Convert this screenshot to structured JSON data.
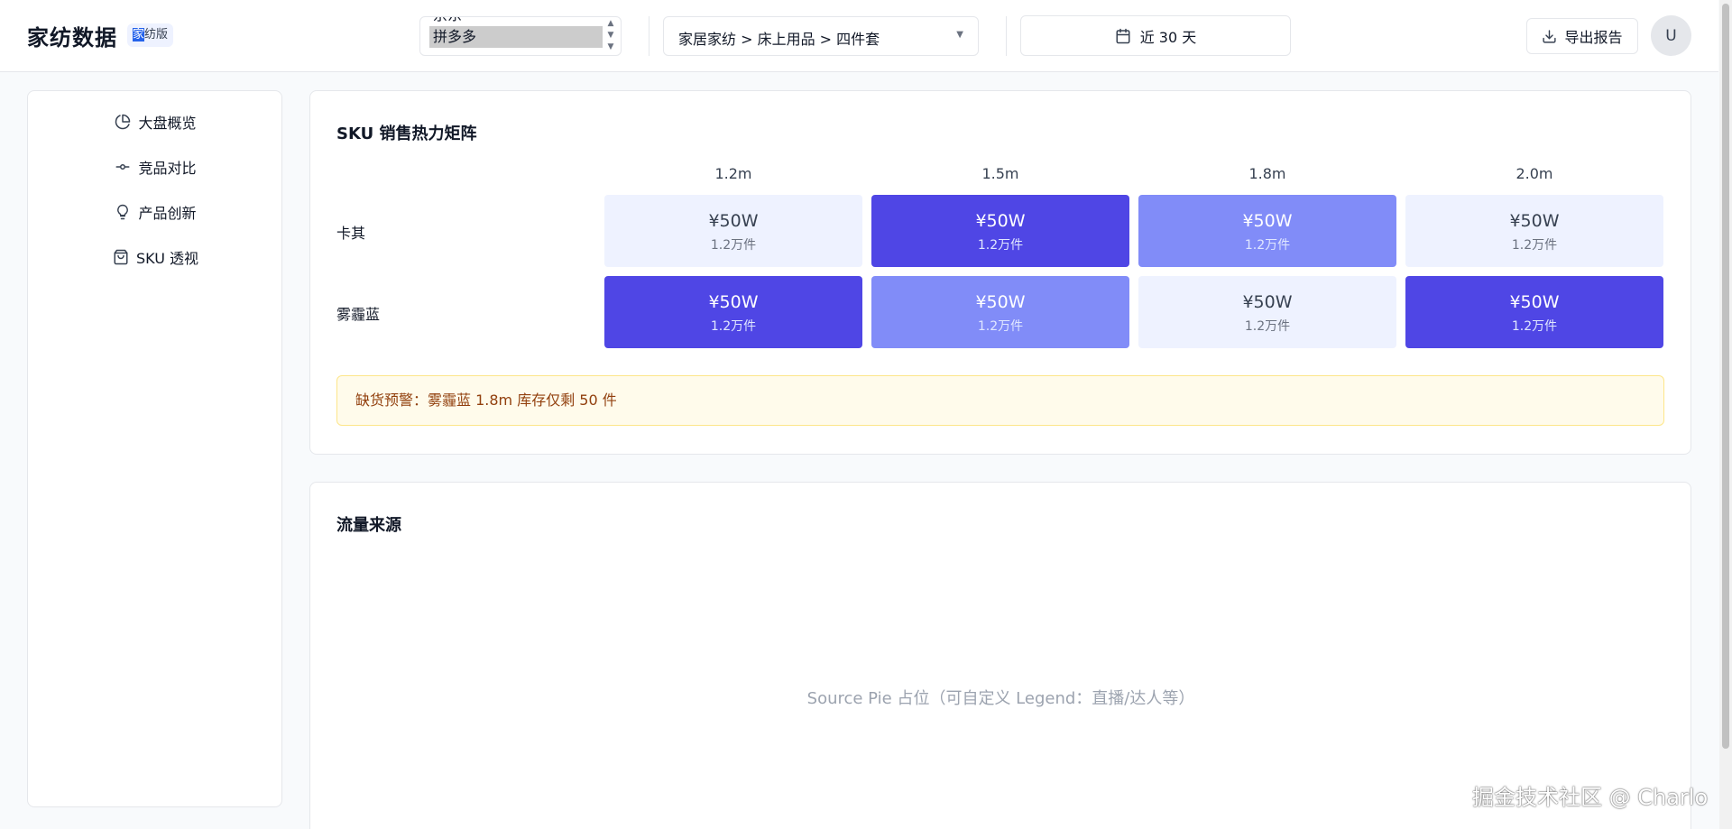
{
  "header": {
    "brand": "家纺数据",
    "badge_highlight": "家",
    "badge_rest": "纺版",
    "platform": {
      "prev_option": "京东",
      "selected": "拼多多"
    },
    "category": "家居家纺 > 床上用品 > 四件套",
    "date_range": "近 30 天",
    "export_label": "导出报告",
    "avatar": "U"
  },
  "sidebar": {
    "items": [
      {
        "label": "大盘概览",
        "icon": "pie-chart-icon"
      },
      {
        "label": "竞品对比",
        "icon": "commit-icon"
      },
      {
        "label": "产品创新",
        "icon": "lightbulb-icon"
      },
      {
        "label": "SKU 透视",
        "icon": "shopping-bag-icon"
      }
    ]
  },
  "heatmap": {
    "title": "SKU 销售热力矩阵",
    "columns": [
      "1.2m",
      "1.5m",
      "1.8m",
      "2.0m"
    ],
    "rows": [
      {
        "label": "卡其",
        "cells": [
          {
            "amount": "¥50W",
            "volume": "1.2万件",
            "level": "low"
          },
          {
            "amount": "¥50W",
            "volume": "1.2万件",
            "level": "high"
          },
          {
            "amount": "¥50W",
            "volume": "1.2万件",
            "level": "mid"
          },
          {
            "amount": "¥50W",
            "volume": "1.2万件",
            "level": "low"
          }
        ]
      },
      {
        "label": "雾霾蓝",
        "cells": [
          {
            "amount": "¥50W",
            "volume": "1.2万件",
            "level": "high"
          },
          {
            "amount": "¥50W",
            "volume": "1.2万件",
            "level": "mid"
          },
          {
            "amount": "¥50W",
            "volume": "1.2万件",
            "level": "low"
          },
          {
            "amount": "¥50W",
            "volume": "1.2万件",
            "level": "high"
          }
        ]
      }
    ],
    "alert": "缺货预警：雾霾蓝 1.8m 库存仅剩 50 件"
  },
  "traffic": {
    "title": "流量来源",
    "placeholder": "Source Pie 占位（可自定义 Legend：直播/达人等）"
  },
  "watermark": "掘金技术社区 @ Charlo",
  "colors": {
    "heat_low": "#eef2ff",
    "heat_mid": "#818cf8",
    "heat_high": "#4f46e5",
    "alert_bg": "#fffbeb",
    "alert_text": "#92400e"
  }
}
